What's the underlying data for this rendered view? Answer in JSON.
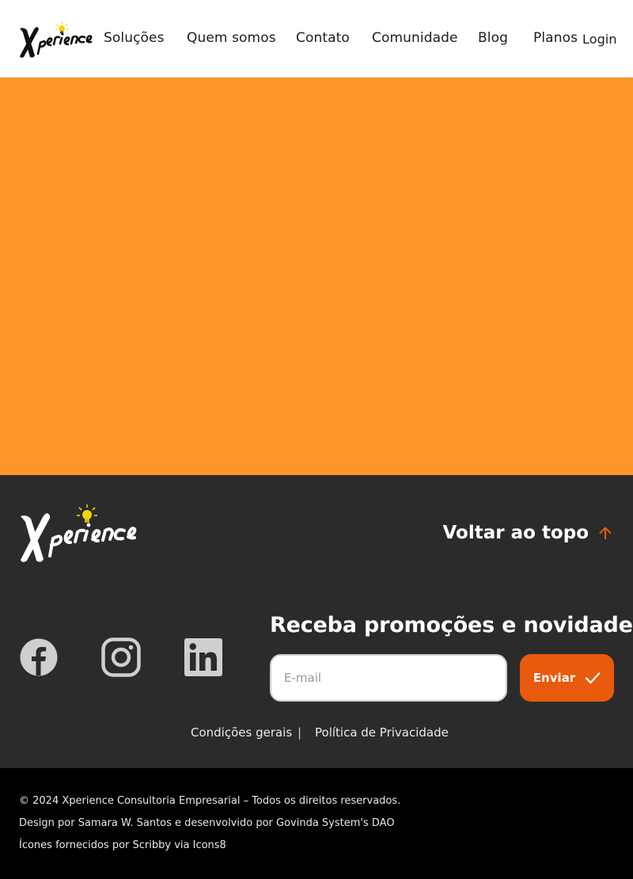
{
  "header": {
    "logo_text": "Xperience",
    "nav": [
      {
        "label": "Soluções"
      },
      {
        "label": "Quem somos"
      },
      {
        "label": "Contato"
      },
      {
        "label": "Comunidade"
      },
      {
        "label": "Blog"
      },
      {
        "label": "Planos"
      }
    ],
    "login_label": "Login"
  },
  "hero": {
    "background": "#fd952b"
  },
  "footer": {
    "logo_text": "Xperience",
    "back_to_top_label": "Voltar ao topo",
    "social_icons": [
      "facebook-icon",
      "instagram-icon",
      "linkedin-icon"
    ],
    "newsletter": {
      "title": "Receba promoções e novidades",
      "email_placeholder": "E-mail",
      "send_label": "Enviar"
    },
    "links": {
      "terms": "Condições gerais",
      "separator": "|",
      "privacy": "Política de Privacidade"
    }
  },
  "bottom_bar": {
    "copyright": "© 2024 Xperience Consultoria Empresarial – Todos os direitos reservados.",
    "design_credit": "Design por Samara W. Santos e desenvolvido por Govinda System's DAO",
    "icons_credit": "Ícones fornecidos por Scribby via Icons8"
  },
  "colors": {
    "accent": "#fd952b",
    "button": "#e85a0c",
    "footer_bg": "#2b2b2b",
    "bottom_bg": "#000000",
    "bulb": "#f5d20a"
  }
}
